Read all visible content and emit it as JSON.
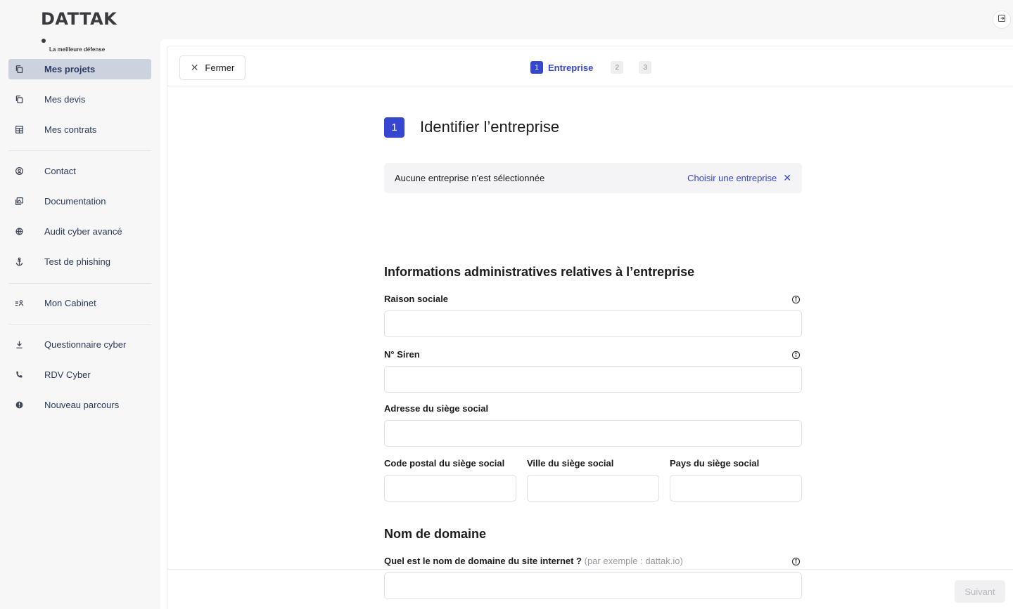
{
  "brand": {
    "name": "DATTAK",
    "tagline": "La meilleure défense"
  },
  "sidebar": {
    "items": [
      {
        "label": "Mes projets",
        "icon": "copy-icon",
        "active": true
      },
      {
        "label": "Mes devis",
        "icon": "copy-icon",
        "active": false
      },
      {
        "label": "Mes contrats",
        "icon": "table-icon",
        "active": false
      },
      {
        "label": "Contact",
        "icon": "user-circle-icon",
        "active": false
      },
      {
        "label": "Documentation",
        "icon": "images-icon",
        "active": false
      },
      {
        "label": "Audit cyber avancé",
        "icon": "globe-icon",
        "active": false
      },
      {
        "label": "Test de phishing",
        "icon": "anchor-icon",
        "active": false
      },
      {
        "label": "Mon Cabinet",
        "icon": "team-icon",
        "active": false
      },
      {
        "label": "Questionnaire cyber",
        "icon": "download-icon",
        "active": false
      },
      {
        "label": "RDV Cyber",
        "icon": "phone-icon",
        "active": false
      },
      {
        "label": "Nouveau parcours",
        "icon": "alert-icon",
        "active": false
      }
    ]
  },
  "topbar": {
    "close_label": "Fermer",
    "steps": [
      {
        "number": "1",
        "label": "Entreprise",
        "active": true
      },
      {
        "number": "2",
        "label": "",
        "active": false
      },
      {
        "number": "3",
        "label": "",
        "active": false
      }
    ]
  },
  "form": {
    "step_number": "1",
    "title": "Identifier l’entreprise",
    "company_box": {
      "message": "Aucune entreprise n’est sélectionnée",
      "action": "Choisir une entreprise"
    },
    "section_admin": "Informations administratives relatives à l’entreprise",
    "fields": {
      "raison_sociale": {
        "label": "Raison sociale",
        "value": ""
      },
      "siren": {
        "label": "N° Siren",
        "value": ""
      },
      "adresse": {
        "label": "Adresse du siège social",
        "value": ""
      },
      "code_postal": {
        "label": "Code postal du siège social",
        "value": ""
      },
      "ville": {
        "label": "Ville du siège social",
        "value": ""
      },
      "pays": {
        "label": "Pays du siège social",
        "value": ""
      }
    },
    "section_domain": "Nom de domaine",
    "domain_field": {
      "label": "Quel est le nom de domaine du site internet ?",
      "hint": "(par exemple : dattak.io)",
      "value": ""
    }
  },
  "footer": {
    "next_label": "Suivant"
  },
  "colors": {
    "accent": "#3746cf",
    "active_nav": "#cdd3de"
  }
}
